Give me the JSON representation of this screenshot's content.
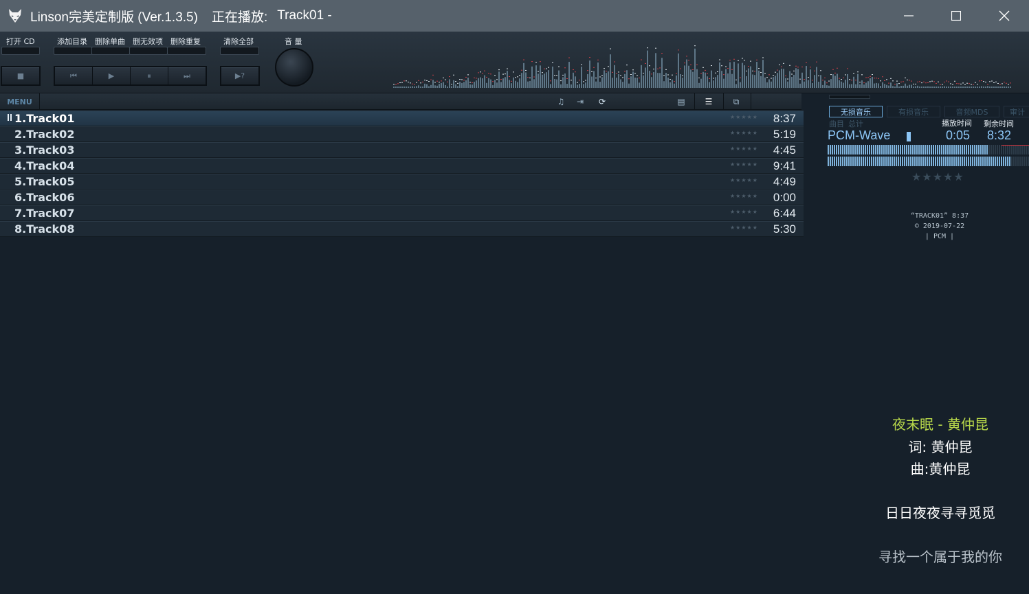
{
  "window": {
    "title": "Linson完美定制版 (Ver.1.3.5)",
    "now_playing_label": "正在播放:",
    "now_playing_value": "Track01 -"
  },
  "toolbar": {
    "open_cd": "打开 CD",
    "add_dir": "添加目录",
    "delete_single": "删除单曲",
    "delete_invalid": "删无效项",
    "delete_duplicate": "删除重复",
    "clear_all": "清除全部",
    "volume": "音 量",
    "unknown_button": "▶?"
  },
  "playlist": {
    "menu_label": "MENU",
    "rows": [
      {
        "name": "1.Track01",
        "time": "8:37"
      },
      {
        "name": "2.Track02",
        "time": "5:19"
      },
      {
        "name": "3.Track03",
        "time": "4:45"
      },
      {
        "name": "4.Track04",
        "time": "9:41"
      },
      {
        "name": "5.Track05",
        "time": "4:49"
      },
      {
        "name": "6.Track06",
        "time": "0:00"
      },
      {
        "name": "7.Track07",
        "time": "6:44"
      },
      {
        "name": "8.Track08",
        "time": "5:30"
      }
    ],
    "rating_stars": "★★★★★"
  },
  "right_panel": {
    "tabs": [
      "无损音乐",
      "有损音乐",
      "音频MDS",
      "审计"
    ],
    "track_label": "曲目",
    "total_label": "总计",
    "play_time_label": "播放时间",
    "remain_time_label": "剩余时间",
    "format": "PCM-Wave",
    "elapsed": "0:05",
    "remaining": "8:32",
    "rating": "★★★★★",
    "info_title": "“TRACK01” 8:37",
    "info_date": "© 2019-07-22",
    "info_format": "| PCM |"
  },
  "lyrics": {
    "title": "夜末眠 - 黄仲昆",
    "lyricist": "词:  黄仲昆",
    "composer": "曲:黄仲昆",
    "line1": "日日夜夜寻寻觅觅",
    "line2": "寻找一个属于我的你"
  },
  "colors": {
    "background": "#16202a",
    "titlebar": "#56616b",
    "lyric_title": "#b8d84a",
    "accent_blue": "#8cc5f5"
  }
}
